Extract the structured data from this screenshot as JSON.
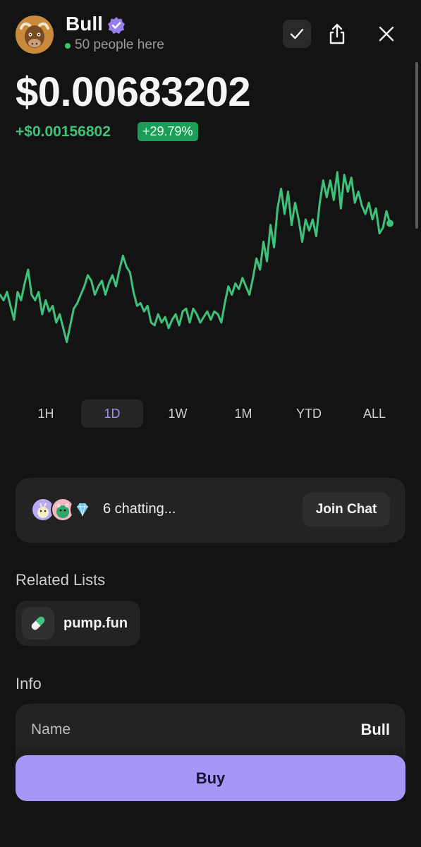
{
  "header": {
    "token_name": "Bull",
    "people_here": "50 people here",
    "avatar_icon": "bull-avatar-icon",
    "verified_icon": "verified-badge-icon",
    "actions": [
      "check-icon",
      "share-icon",
      "close-icon"
    ]
  },
  "price": {
    "value": "$0.00683202",
    "change": "+$0.00156802",
    "change_percent": "+29.79%"
  },
  "colors": {
    "accent": "#a796f5",
    "positive": "#3ec27a",
    "positive_badge": "#1d9c57",
    "background": "#131313",
    "card": "#232323"
  },
  "chart_data": {
    "type": "line",
    "title": "",
    "xlabel": "",
    "ylabel": "",
    "grid": false,
    "x_range_label": "1D",
    "ylim": [
      0.0041,
      0.0079
    ],
    "series": [
      {
        "color": "#3ec27a",
        "values": [
          0.00555,
          0.00545,
          0.0056,
          0.00535,
          0.0051,
          0.0056,
          0.00545,
          0.00575,
          0.006,
          0.00555,
          0.00545,
          0.0056,
          0.0052,
          0.00545,
          0.00525,
          0.00535,
          0.00505,
          0.0052,
          0.00495,
          0.0047,
          0.005,
          0.0053,
          0.0054,
          0.00555,
          0.0057,
          0.0059,
          0.0058,
          0.00555,
          0.0057,
          0.0058,
          0.00555,
          0.00575,
          0.0059,
          0.0057,
          0.006,
          0.00625,
          0.00605,
          0.00595,
          0.0056,
          0.00535,
          0.0054,
          0.00525,
          0.00535,
          0.00505,
          0.005,
          0.0052,
          0.00505,
          0.00515,
          0.00495,
          0.0051,
          0.0052,
          0.005,
          0.00525,
          0.0053,
          0.00505,
          0.0053,
          0.0052,
          0.00505,
          0.00515,
          0.00525,
          0.0051,
          0.00525,
          0.0052,
          0.00505,
          0.0054,
          0.0057,
          0.00555,
          0.00575,
          0.00565,
          0.00585,
          0.0057,
          0.00555,
          0.00585,
          0.0062,
          0.006,
          0.0065,
          0.00615,
          0.0068,
          0.0064,
          0.0071,
          0.00745,
          0.007,
          0.0074,
          0.0068,
          0.0072,
          0.0069,
          0.0065,
          0.0069,
          0.0067,
          0.0069,
          0.0066,
          0.0072,
          0.0076,
          0.0073,
          0.0076,
          0.00725,
          0.00775,
          0.0071,
          0.0077,
          0.0074,
          0.00765,
          0.0072,
          0.0074,
          0.00715,
          0.007,
          0.0072,
          0.0069,
          0.0071,
          0.00665,
          0.00675,
          0.00705,
          0.00683
        ]
      }
    ]
  },
  "time_ranges": {
    "options": [
      "1H",
      "1D",
      "1W",
      "1M",
      "YTD",
      "ALL"
    ],
    "selected": "1D"
  },
  "chat": {
    "status": "6 chatting...",
    "join_label": "Join Chat",
    "avatars": [
      "chat-avatar-1",
      "chat-avatar-2",
      "diamond-icon"
    ]
  },
  "related_lists": {
    "title": "Related Lists",
    "items": [
      {
        "label": "pump.fun",
        "icon": "pill-icon"
      }
    ]
  },
  "info": {
    "title": "Info",
    "rows": [
      {
        "key": "Name",
        "value": "Bull"
      }
    ]
  },
  "buy_label": "Buy"
}
